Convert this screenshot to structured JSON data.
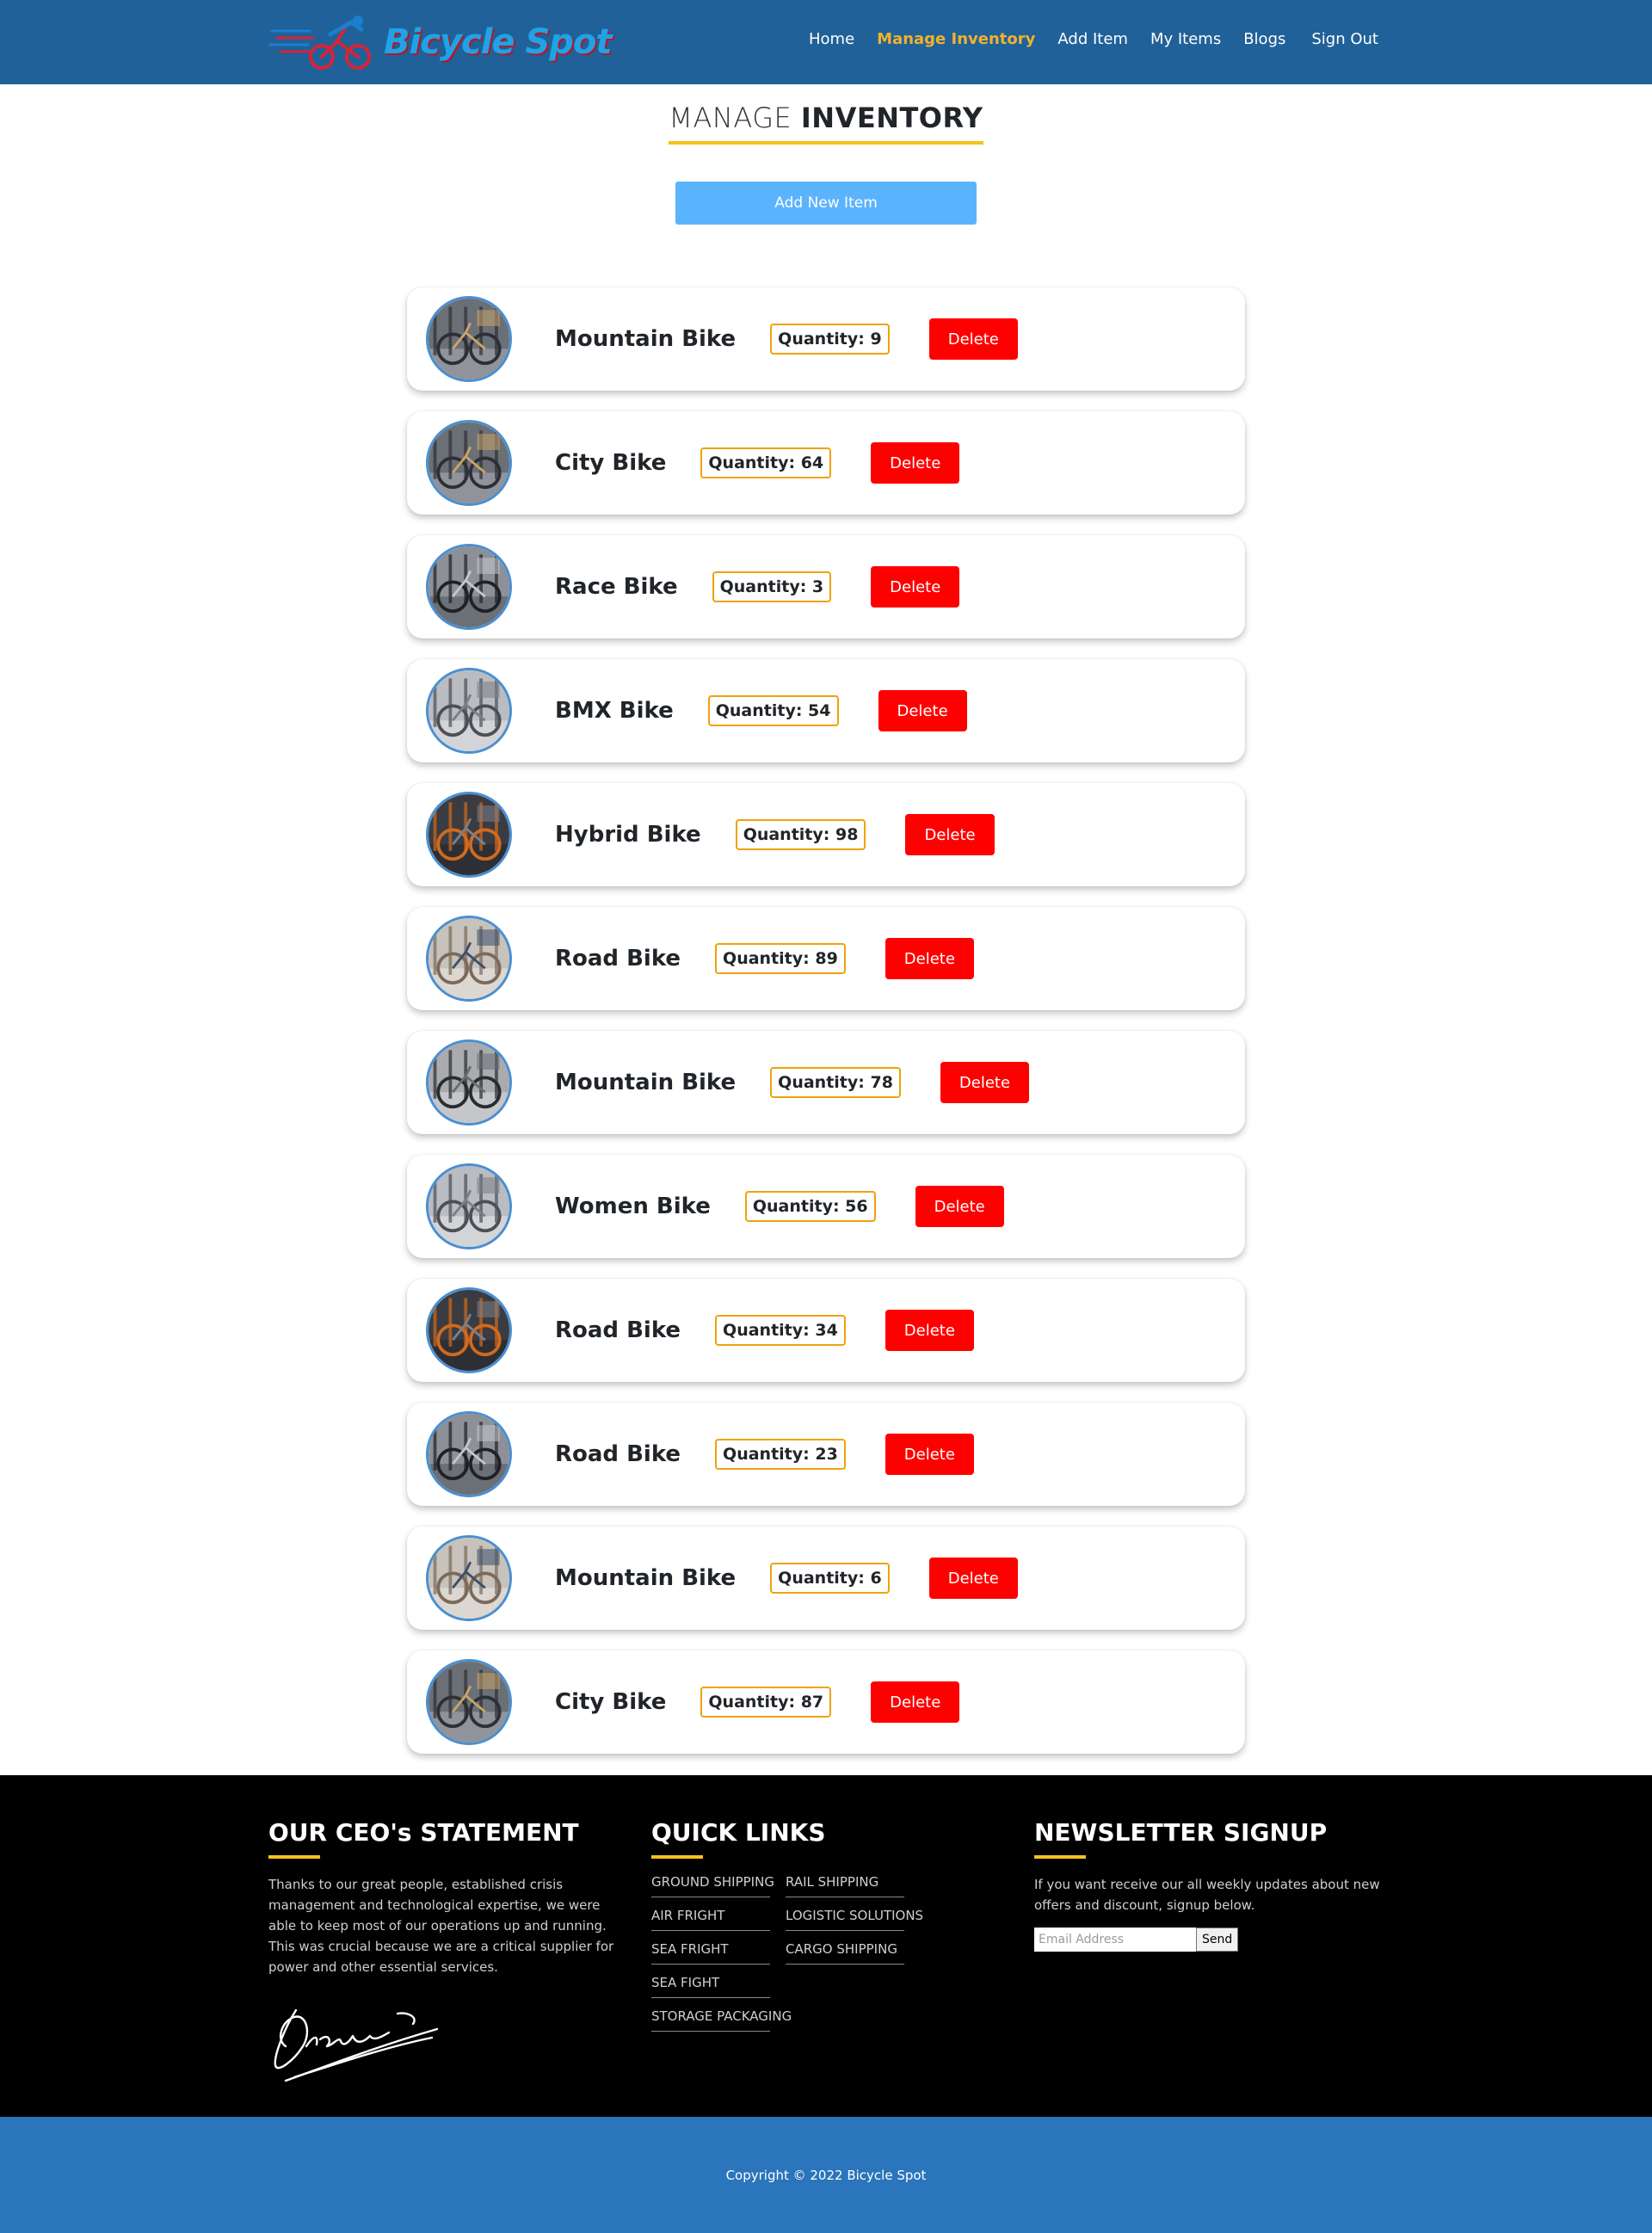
{
  "brand": {
    "name": "Bicycle Spot",
    "logo_icon": "cyclist-logo-icon",
    "colors": {
      "text": "#1fa3e6",
      "shadow": "#b01a2c"
    }
  },
  "nav": {
    "home": "Home",
    "manage_inventory": "Manage Inventory",
    "add_item": "Add Item",
    "my_items": "My Items",
    "blogs": "Blogs",
    "sign_out": "Sign Out",
    "active": "Manage Inventory",
    "colors": {
      "bar": "#206199",
      "active_link": "#f2b12d"
    }
  },
  "page": {
    "title_light": "MANAGE",
    "title_strong": "INVENTORY",
    "add_new_button": "Add New Item"
  },
  "inventory": {
    "delete_label": "Delete",
    "items": [
      {
        "name": "Mountain Bike",
        "quantity": "Quantity: 9",
        "image": "bike-shop-photo"
      },
      {
        "name": "City Bike",
        "quantity": "Quantity: 64",
        "image": "bike-shop-photo"
      },
      {
        "name": "Race Bike",
        "quantity": "Quantity: 3",
        "image": "bike-tires-photo"
      },
      {
        "name": "BMX Bike",
        "quantity": "Quantity: 54",
        "image": "bike-store-photo"
      },
      {
        "name": "Hybrid Bike",
        "quantity": "Quantity: 98",
        "image": "bike-rack-photo"
      },
      {
        "name": "Road Bike",
        "quantity": "Quantity: 89",
        "image": "mechanic-photo"
      },
      {
        "name": "Mountain Bike",
        "quantity": "Quantity: 78",
        "image": "bike-wheels-photo"
      },
      {
        "name": "Women Bike",
        "quantity": "Quantity: 56",
        "image": "bike-store-photo"
      },
      {
        "name": "Road Bike",
        "quantity": "Quantity: 34",
        "image": "bike-rack-photo"
      },
      {
        "name": "Road Bike",
        "quantity": "Quantity: 23",
        "image": "bike-tires-photo"
      },
      {
        "name": "Mountain Bike",
        "quantity": "Quantity: 6",
        "image": "mechanic-photo"
      },
      {
        "name": "City Bike",
        "quantity": "Quantity: 87",
        "image": "bike-shop-photo"
      }
    ]
  },
  "footer": {
    "ceo": {
      "title": "OUR CEO's STATEMENT",
      "text": "Thanks to our great people, established crisis management and technological expertise, we were able to keep most of our operations up and running. This was crucial because we are a critical supplier for power and other essential services.",
      "signature_icon": "signature-icon"
    },
    "quick_links": {
      "title": "QUICK LINKS",
      "links": [
        "GROUND SHIPPING",
        "RAIL SHIPPING",
        "AIR FRIGHT",
        "LOGISTIC SOLUTIONS",
        "SEA FRIGHT",
        "CARGO SHIPPING",
        "SEA FIGHT",
        "STORAGE PACKAGING"
      ]
    },
    "newsletter": {
      "title": "NEWSLETTER SIGNUP",
      "text": "If you want receive our all weekly updates about new offers and discount, signup below.",
      "placeholder": "Email Address",
      "send": "Send"
    },
    "accent": "#f5c21b"
  },
  "copyright": "Copyright © 2022 Bicycle Spot"
}
